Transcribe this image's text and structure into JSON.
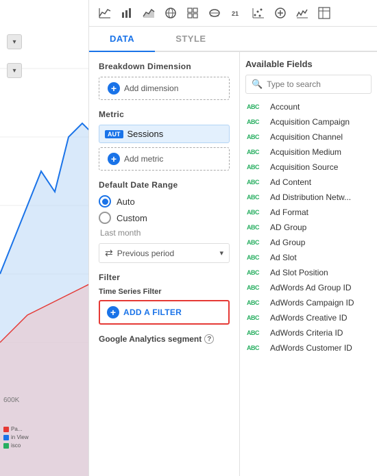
{
  "toolbar": {
    "icons": [
      {
        "name": "line-chart-icon",
        "symbol": "📈"
      },
      {
        "name": "bar-chart-icon",
        "symbol": "📊"
      },
      {
        "name": "area-chart-icon",
        "symbol": "📉"
      },
      {
        "name": "globe-icon",
        "symbol": "🌐"
      },
      {
        "name": "grid-icon",
        "symbol": "⊞"
      },
      {
        "name": "world-icon",
        "symbol": "🗺"
      },
      {
        "name": "number-icon",
        "symbol": "21"
      },
      {
        "name": "scatter-icon",
        "symbol": "⁞⁞"
      },
      {
        "name": "bullet-icon",
        "symbol": "⊕"
      },
      {
        "name": "sparkline-icon",
        "symbol": "〰"
      },
      {
        "name": "pivot-icon",
        "symbol": "⊟"
      }
    ]
  },
  "tabs": {
    "items": [
      {
        "label": "DATA",
        "active": true
      },
      {
        "label": "STYLE",
        "active": false
      }
    ]
  },
  "config": {
    "breakdown_title": "Breakdown Dimension",
    "add_dimension_label": "Add dimension",
    "metric_title": "Metric",
    "metric_aut": "AUT",
    "metric_name": "Sessions",
    "add_metric_label": "Add metric",
    "date_range_title": "Default Date Range",
    "auto_label": "Auto",
    "custom_label": "Custom",
    "last_month_label": "Last month",
    "previous_period_label": "Previous period",
    "filter_title": "Filter",
    "ts_filter_label": "Time Series Filter",
    "add_filter_label": "ADD A FILTER",
    "ga_segment_label": "Google Analytics segment",
    "help_char": "?"
  },
  "fields": {
    "title": "Available Fields",
    "search_placeholder": "Type to search",
    "items": [
      "Account",
      "Acquisition Campaign",
      "Acquisition Channel",
      "Acquisition Medium",
      "Acquisition Source",
      "Ad Content",
      "Ad Distribution Netw...",
      "Ad Format",
      "AD Group",
      "Ad Group",
      "Ad Slot",
      "Ad Slot Position",
      "AdWords Ad Group ID",
      "AdWords Campaign ID",
      "AdWords Creative ID",
      "AdWords Criteria ID",
      "AdWords Customer ID"
    ]
  },
  "sidebar": {
    "600k_label": "600K",
    "dot1": "•",
    "dot2": "•"
  }
}
